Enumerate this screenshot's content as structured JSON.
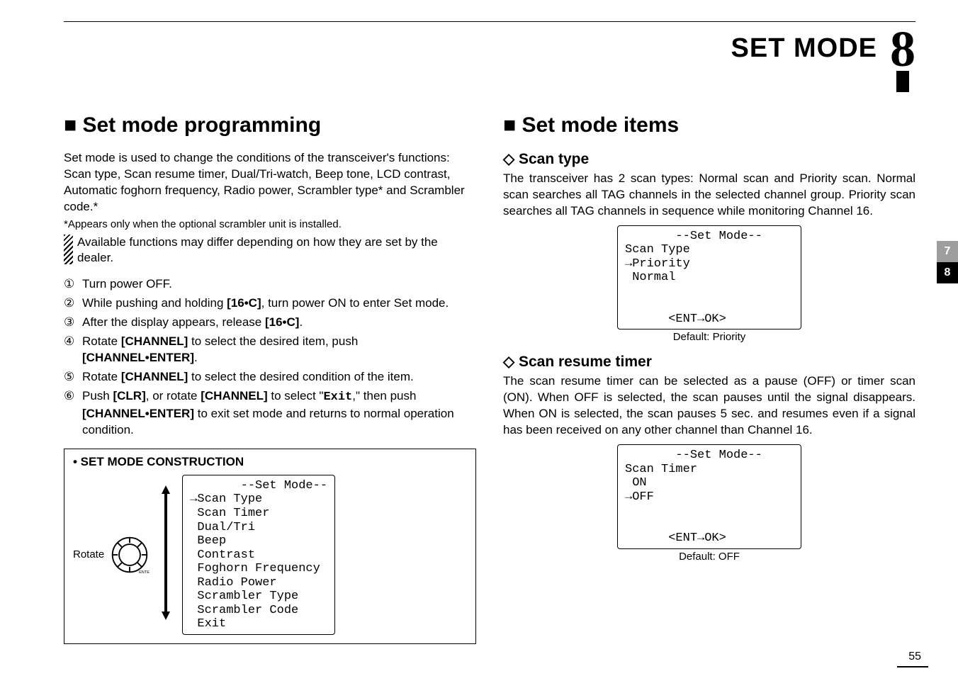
{
  "header": {
    "title": "SET MODE",
    "chapter": "8"
  },
  "tabs": {
    "a": "7",
    "b": "8"
  },
  "pageNumber": "55",
  "left": {
    "heading": "■ Set mode programming",
    "lead": "Set mode is used to change the conditions of the transceiver's functions: Scan type, Scan resume timer, Dual/Tri-watch, Beep tone, LCD contrast, Automatic foghorn frequency, Radio power, Scrambler type* and Scrambler code.*",
    "asterisk": "*Appears only when the optional scrambler unit is installed.",
    "hatched": "Available functions may differ depending on how they are set by the dealer.",
    "steps": {
      "s1": "Turn power OFF.",
      "s2a": "While pushing and holding ",
      "s2b": "[16•C]",
      "s2c": ", turn power ON to enter Set mode.",
      "s3a": "After the display appears, release ",
      "s3b": "[16•C]",
      "s3c": ".",
      "s4a": "Rotate ",
      "s4b": "[CHANNEL]",
      "s4c": " to select the desired item, push ",
      "s4d": "[CHANNEL•ENTER]",
      "s4e": ".",
      "s5a": "Rotate ",
      "s5b": "[CHANNEL]",
      "s5c": " to select the desired condition of the item.",
      "s6a": "Push ",
      "s6b": "[CLR]",
      "s6c": ", or rotate ",
      "s6d": "[CHANNEL]",
      "s6e": " to select \"",
      "s6f": "Exit",
      "s6g": ",\" then push ",
      "s6h": "[CHANNEL•ENTER]",
      "s6i": " to exit set mode and returns to normal operation condition."
    },
    "box": {
      "title": "• SET MODE CONSTRUCTION",
      "rotate": "Rotate",
      "lcd": "       --Set Mode--\n→Scan Type\n Scan Timer\n Dual/Tri\n Beep\n Contrast\n Foghorn Frequency\n Radio Power\n Scrambler Type\n Scrambler Code\n Exit"
    }
  },
  "right": {
    "heading": "■ Set mode items",
    "scanType": {
      "title": "◇ Scan type",
      "body": "The transceiver has 2 scan types: Normal scan and Priority scan. Normal scan searches all TAG channels in the selected channel group. Priority scan searches all TAG channels in sequence while monitoring Channel 16.",
      "lcd": "       --Set Mode--\nScan Type\n→Priority\n Normal\n\n\n      <ENT→OK>",
      "caption": "Default: Priority"
    },
    "scanTimer": {
      "title": "◇ Scan resume timer",
      "body": "The scan resume timer can be selected as a pause (OFF) or timer scan (ON). When OFF is selected, the scan pauses until the signal disappears. When ON is selected, the scan pauses 5 sec. and resumes even if a signal has been received on any other channel than Channel 16.",
      "lcd": "       --Set Mode--\nScan Timer\n ON\n→OFF\n\n\n      <ENT→OK>",
      "caption": "Default: OFF"
    }
  }
}
